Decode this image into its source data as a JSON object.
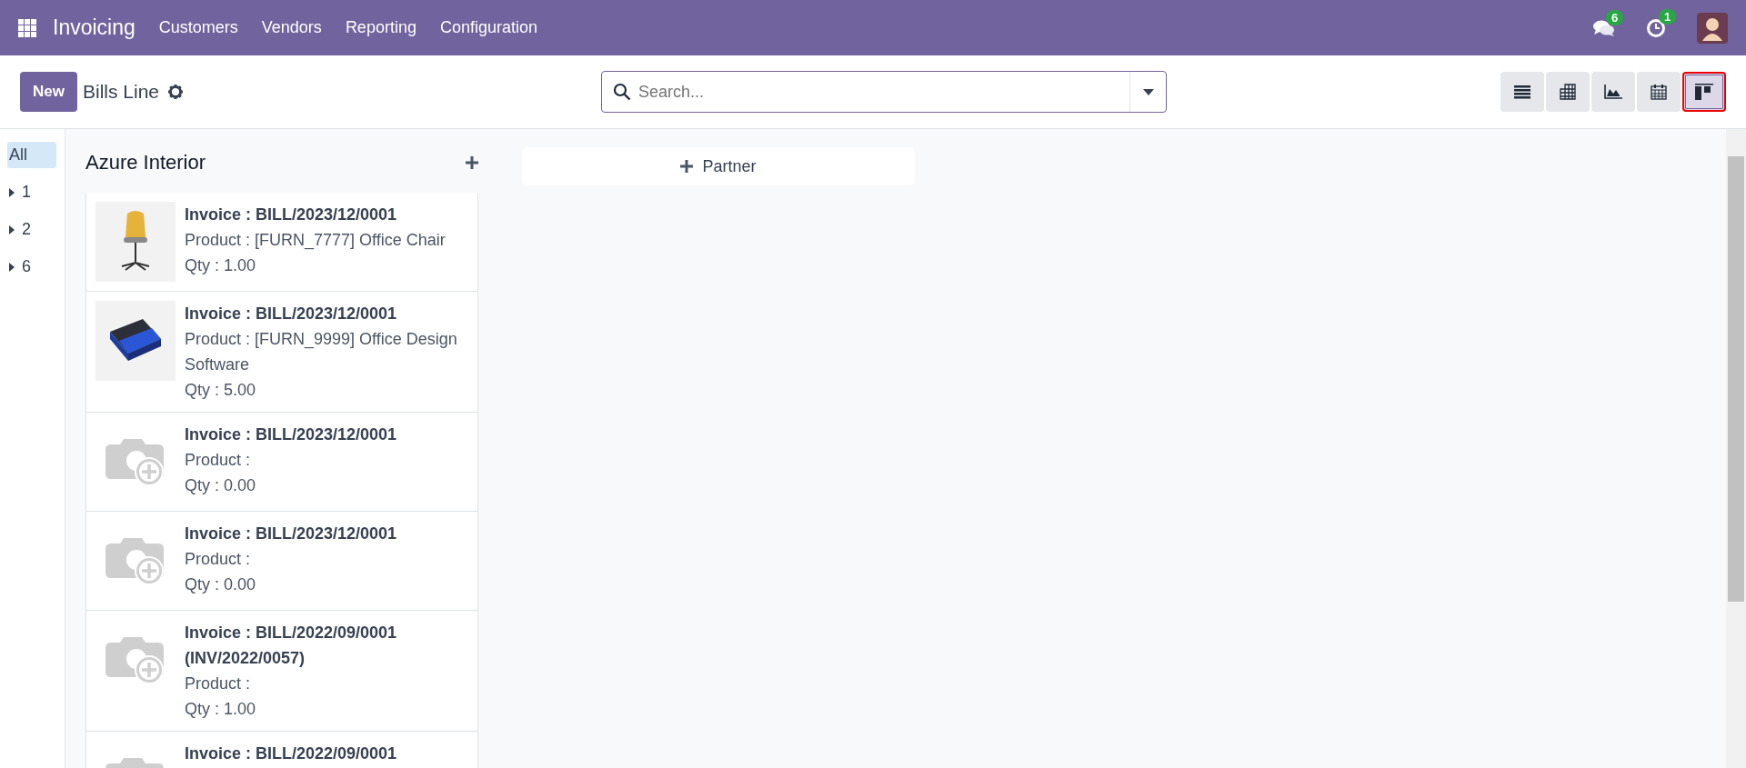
{
  "navbar": {
    "app_name": "Invoicing",
    "menu": [
      "Customers",
      "Vendors",
      "Reporting",
      "Configuration"
    ],
    "messages_count": "6",
    "activities_count": "1"
  },
  "control_panel": {
    "new_button": "New",
    "title": "Bills Line",
    "search": {
      "placeholder": "Search..."
    },
    "views": [
      {
        "kind": "list",
        "selected": false
      },
      {
        "kind": "pivot",
        "selected": false
      },
      {
        "kind": "graph",
        "selected": false
      },
      {
        "kind": "calendar",
        "selected": false
      },
      {
        "kind": "kanban",
        "selected": true
      }
    ]
  },
  "sidebar": {
    "items": [
      {
        "label": "All",
        "selected": true,
        "expandable": false
      },
      {
        "label": "1",
        "selected": false,
        "expandable": true
      },
      {
        "label": "2",
        "selected": false,
        "expandable": true
      },
      {
        "label": "6",
        "selected": false,
        "expandable": true
      }
    ]
  },
  "column": {
    "title": "Azure Interior",
    "cards": [
      {
        "kind": "chair",
        "invoice": "Invoice : BILL/2023/12/0001",
        "product": "Product : [FURN_7777] Office Chair",
        "qty": "Qty : 1.00"
      },
      {
        "kind": "software",
        "invoice": "Invoice : BILL/2023/12/0001",
        "product": "Product : [FURN_9999] Office Design Software",
        "qty": "Qty : 5.00"
      },
      {
        "kind": "placeholder",
        "invoice": "Invoice : BILL/2023/12/0001",
        "product": "Product :",
        "qty": "Qty : 0.00"
      },
      {
        "kind": "placeholder",
        "invoice": "Invoice : BILL/2023/12/0001",
        "product": "Product :",
        "qty": "Qty : 0.00"
      },
      {
        "kind": "placeholder",
        "invoice": "Invoice : BILL/2022/09/0001 (INV/2022/0057)",
        "product": "Product :",
        "qty": "Qty : 1.00"
      },
      {
        "kind": "placeholder",
        "invoice": "Invoice : BILL/2022/09/0001"
      }
    ]
  },
  "add_column": {
    "label": "Partner"
  }
}
